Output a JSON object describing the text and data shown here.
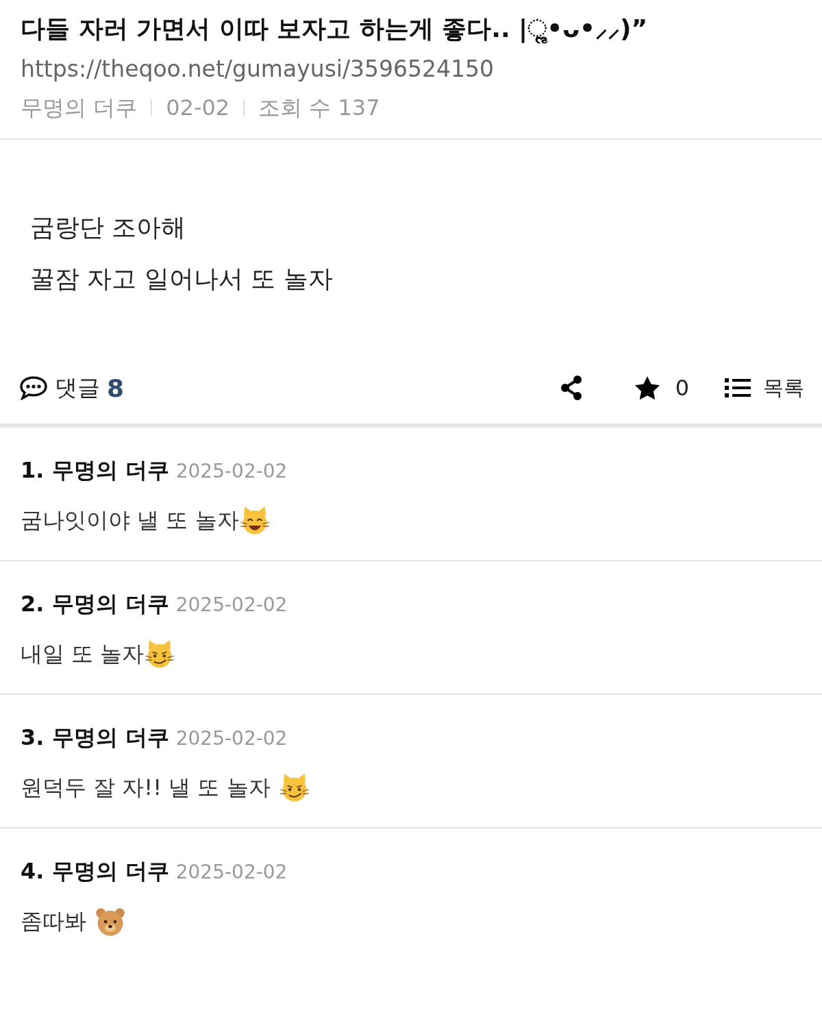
{
  "post": {
    "title": "다들 자러 가면서 이따 보자고 하는게 좋다.. |ૢ•ᴗ•⸝⸝)”",
    "url": "https://theqoo.net/gumayusi/3596524150",
    "author": "무명의 더쿠",
    "date": "02-02",
    "views": "조회 수 137",
    "body": [
      "굼랑단 조아해",
      "꿀잠 자고 일어나서 또 놀자"
    ]
  },
  "actions": {
    "comments_label": "댓글",
    "comments_count": "8",
    "stars": "0",
    "list_label": "목록"
  },
  "comments": [
    {
      "number": "1.",
      "author": "무명의 더쿠",
      "date": "2025-02-02",
      "text": "굼나잇이야 낼 또 놀자",
      "emoji": {
        "kind": "grin",
        "spaced": false
      }
    },
    {
      "number": "2.",
      "author": "무명의 더쿠",
      "date": "2025-02-02",
      "text": "내일 또 놀자",
      "emoji": {
        "kind": "smirk",
        "spaced": false
      }
    },
    {
      "number": "3.",
      "author": "무명의 더쿠",
      "date": "2025-02-02",
      "text": "원덕두 잘 자!! 낼 또 놀자",
      "emoji": {
        "kind": "smirk",
        "spaced": true
      }
    },
    {
      "number": "4.",
      "author": "무명의 더쿠",
      "date": "2025-02-02",
      "text": "좀따봐",
      "emoji": {
        "kind": "bear",
        "spaced": true
      }
    }
  ]
}
